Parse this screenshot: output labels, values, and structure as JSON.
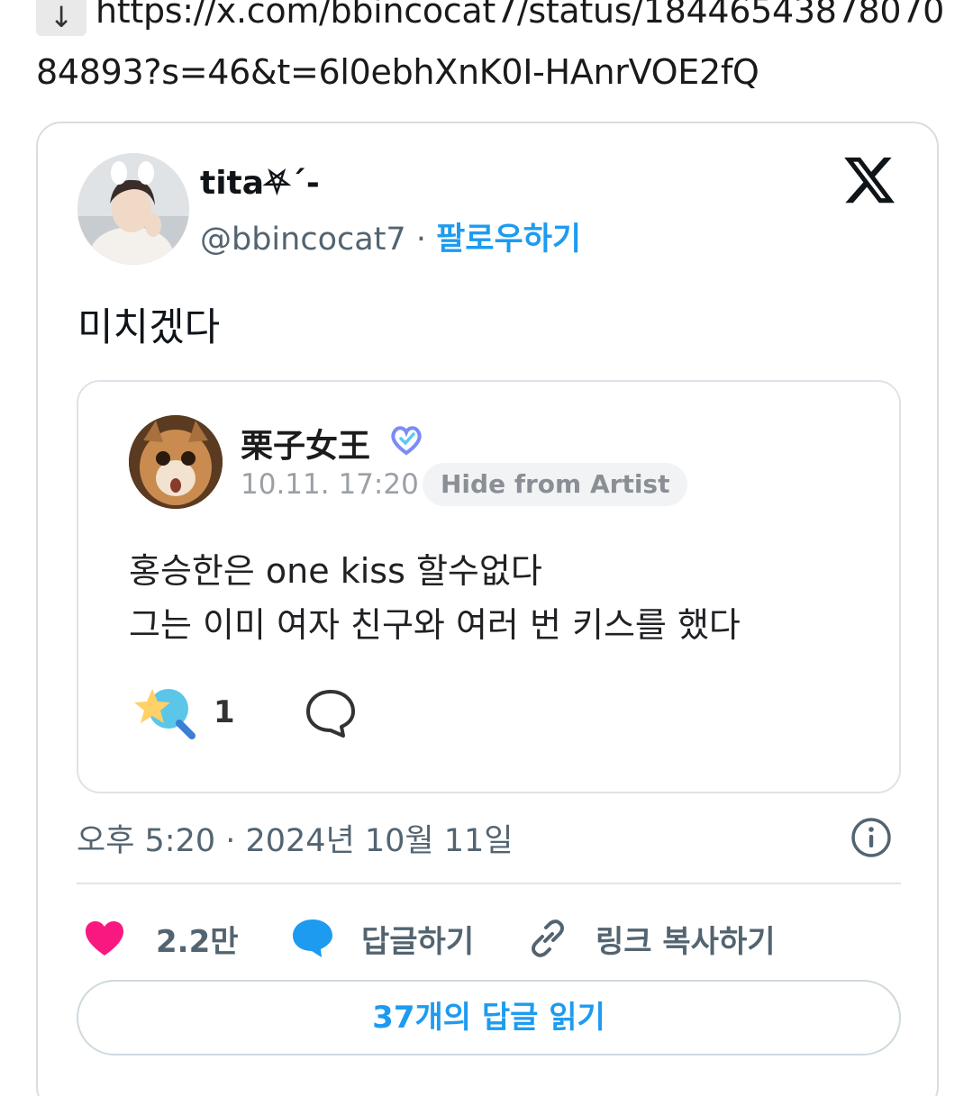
{
  "url": {
    "line1": "https://x.com/bbincocat7/status/18446543878070",
    "line2": "84893?s=46&t=6l0ebhXnK0I-HAnrVOE2fQ",
    "download_icon": "↓"
  },
  "tweet": {
    "display_name": "tita⛧ˊ-",
    "handle": "@bbincocat7",
    "separator": "·",
    "follow_label": "팔로우하기",
    "text": "미치겠다",
    "timestamp": "오후 5:20 · 2024년 10월 11일",
    "icons": {
      "logo": "x-logo-icon",
      "info": "info-icon"
    },
    "quote": {
      "name": "栗子女王",
      "date": "10.11. 17:20",
      "hide_label": "Hide from Artist",
      "line1": "홍승한은 one kiss  할수없다",
      "line2": "그는 이미 여자 친구와 여러 번 키스를 했다",
      "reaction_count": "1",
      "badge_color": "#7b8cf5"
    },
    "actions": {
      "like_count": "2.2만",
      "reply_label": "답글하기",
      "copy_link_label": "링크 복사하기",
      "like_color": "#f91880",
      "reply_color": "#1d9bf0"
    },
    "read_replies_label": "37개의 답글 읽기"
  }
}
